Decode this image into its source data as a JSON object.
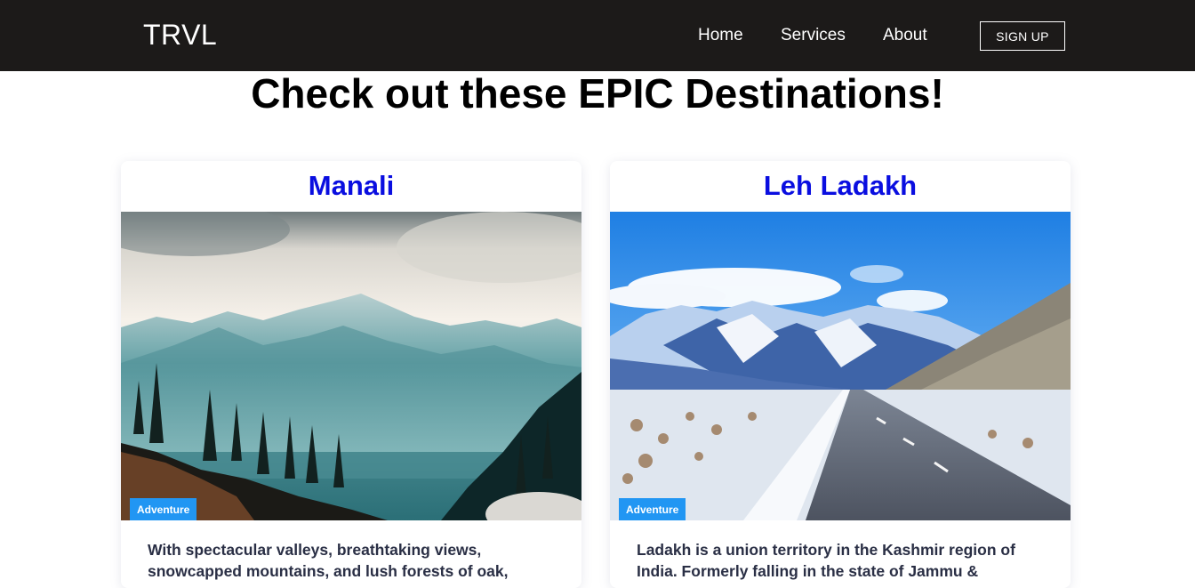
{
  "navbar": {
    "logo": "TRVL",
    "links": [
      {
        "label": "Home"
      },
      {
        "label": "Services"
      },
      {
        "label": "About"
      }
    ],
    "signup_label": "SIGN UP",
    "background": "#1c1a19"
  },
  "main": {
    "heading": "Check out these EPIC Destinations!"
  },
  "cards": [
    {
      "title": "Manali",
      "image": "snowy-mountain-forest-photo",
      "badge": "Adventure",
      "description": "With spectacular valleys, breathtaking views, snowcapped mountains, and lush forests of oak,"
    },
    {
      "title": "Leh Ladakh",
      "image": "mountain-road-snow-photo",
      "badge": "Adventure",
      "description": "Ladakh is a union territory in the Kashmir region of India. Formerly falling in the state of Jammu &"
    }
  ],
  "colors": {
    "card_title": "#0a0ee0",
    "badge": "#2196f3",
    "text": "#2a2f45"
  }
}
